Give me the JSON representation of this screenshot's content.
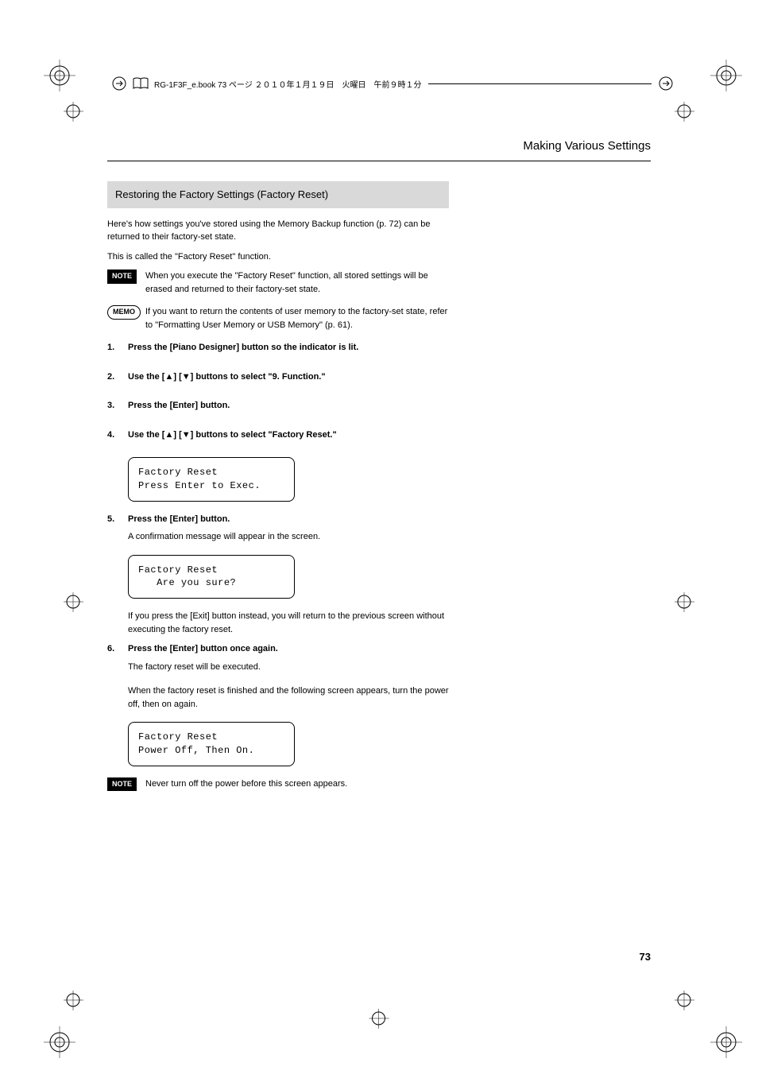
{
  "print_header": {
    "text": "RG-1F3F_e.book  73 ページ  ２０１０年１月１９日　火曜日　午前９時１分"
  },
  "running_header": "Making Various Settings",
  "section_title": "Restoring the Factory Settings (Factory Reset)",
  "intro": {
    "para1": "Here's how settings you've stored using the Memory Backup function (p. 72) can be returned to their factory-set state.",
    "para2": "This is called the \"Factory Reset\" function."
  },
  "note1": {
    "label": "NOTE",
    "text": "When you execute the \"Factory Reset\" function, all stored settings will be erased and returned to their factory-set state."
  },
  "memo1": {
    "label": "MEMO",
    "text": "If you want to return the contents of user memory to the factory-set state, refer to  \"Formatting User Memory or USB Memory\" (p. 61)."
  },
  "steps": {
    "s1": {
      "num": "1.",
      "title": "Press the [Piano Designer] button so the indicator is lit."
    },
    "s2": {
      "num": "2.",
      "title_prefix": "Use the [",
      "title_mid": "] [",
      "title_suffix": "] buttons to select \"9. Function.\""
    },
    "s3": {
      "num": "3.",
      "title": "Press the [Enter] button."
    },
    "s4": {
      "num": "4.",
      "title_prefix": "Use the [",
      "title_mid": "] [",
      "title_suffix": "] buttons to select \"Factory Reset.\""
    },
    "s5": {
      "num": "5.",
      "title": "Press the [Enter] button.",
      "text": "A confirmation message will appear in the screen."
    },
    "s5_after": "If you press the [Exit] button instead, you will return to the previous screen without executing the factory reset.",
    "s6": {
      "num": "6.",
      "title": "Press the [Enter] button once again.",
      "text1": "The factory reset will be executed.",
      "text2": "When the factory reset is finished and the following screen appears, turn the power off, then on again."
    }
  },
  "lcd": {
    "box1_line1": "Factory Reset",
    "box1_line2": "Press Enter to Exec.",
    "box2_line1": "Factory Reset",
    "box2_line2": "   Are you sure?",
    "box3_line1": "Factory Reset",
    "box3_line2": "Power Off, Then On."
  },
  "note2": {
    "label": "NOTE",
    "text": "Never turn off the power before this screen appears."
  },
  "page_number": "73"
}
